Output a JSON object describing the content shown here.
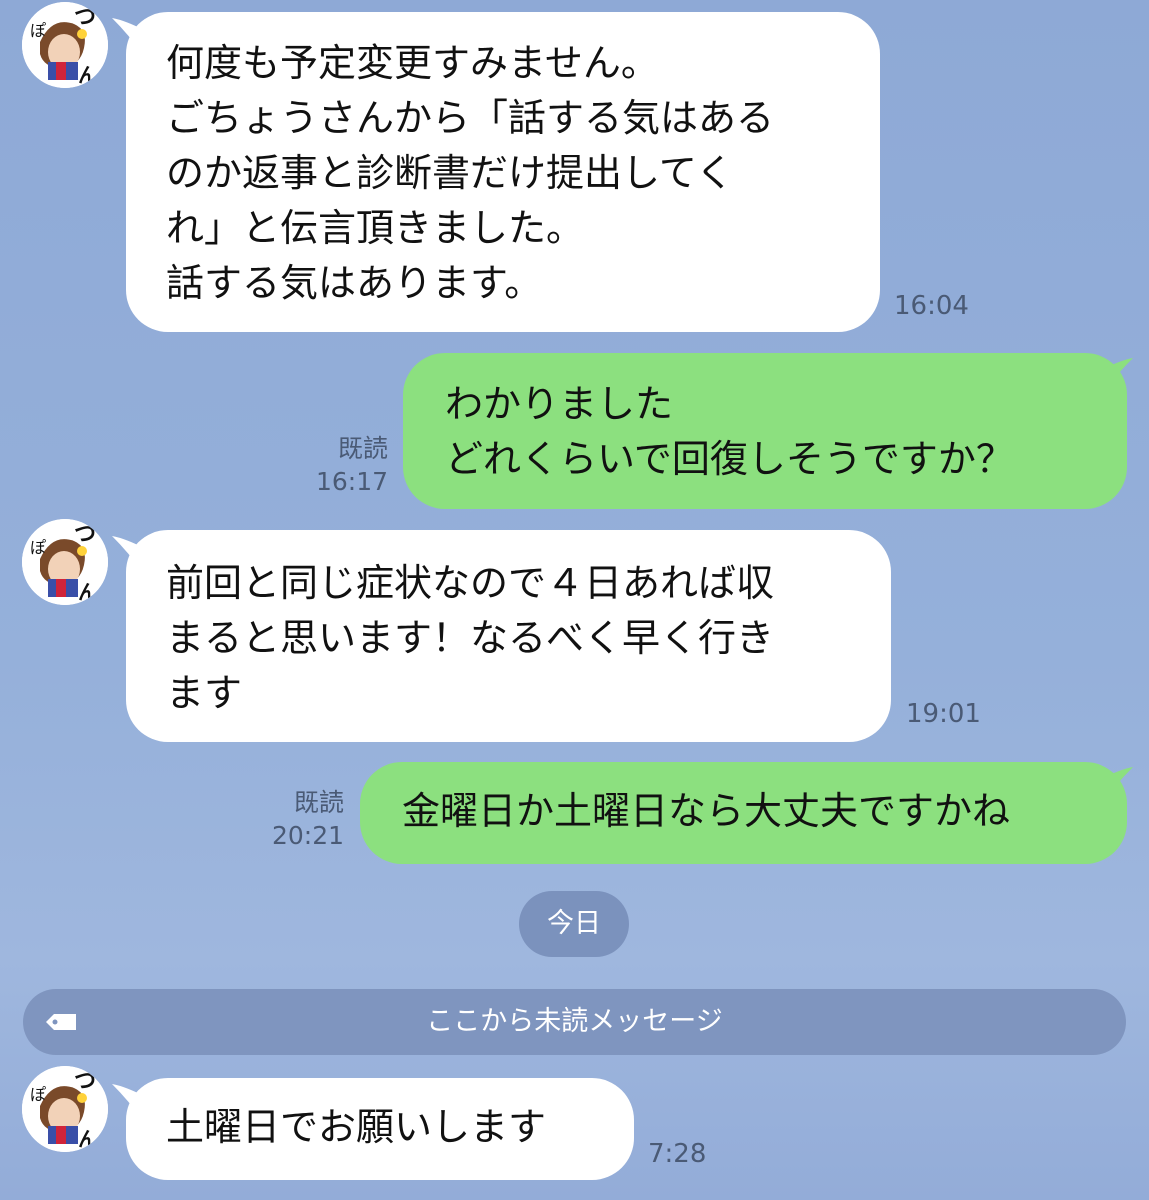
{
  "avatar": {
    "label": "ぽつん",
    "icon": "user-avatar-icon"
  },
  "messages": [
    {
      "direction": "incoming",
      "text": "何度も予定変更すみません。\nごちょうさんから「話する気はある\nのか返事と診断書だけ提出してく\nれ」と伝言頂きました。\n話する気はあります。",
      "time": "16:04"
    },
    {
      "direction": "outgoing",
      "text": "わかりました\nどれくらいで回復しそうですか？",
      "read_label": "既読",
      "time": "16:17"
    },
    {
      "direction": "incoming",
      "text": "前回と同じ症状なので４日あれば収\nまると思います！なるべく早く行き\nます",
      "time": "19:01"
    },
    {
      "direction": "outgoing",
      "text": "金曜日か土曜日なら大丈夫ですかね",
      "read_label": "既読",
      "time": "20:21"
    },
    {
      "direction": "incoming",
      "text": "土曜日でお願いします",
      "time": "7:28"
    }
  ],
  "date_separator": "今日",
  "unread_divider": {
    "label": "ここから未読メッセージ",
    "icon": "tag-icon"
  },
  "colors": {
    "incoming_bubble": "#ffffff",
    "outgoing_bubble": "#8ce07f",
    "background": "#93acd8",
    "meta_text": "#4a5a75"
  }
}
